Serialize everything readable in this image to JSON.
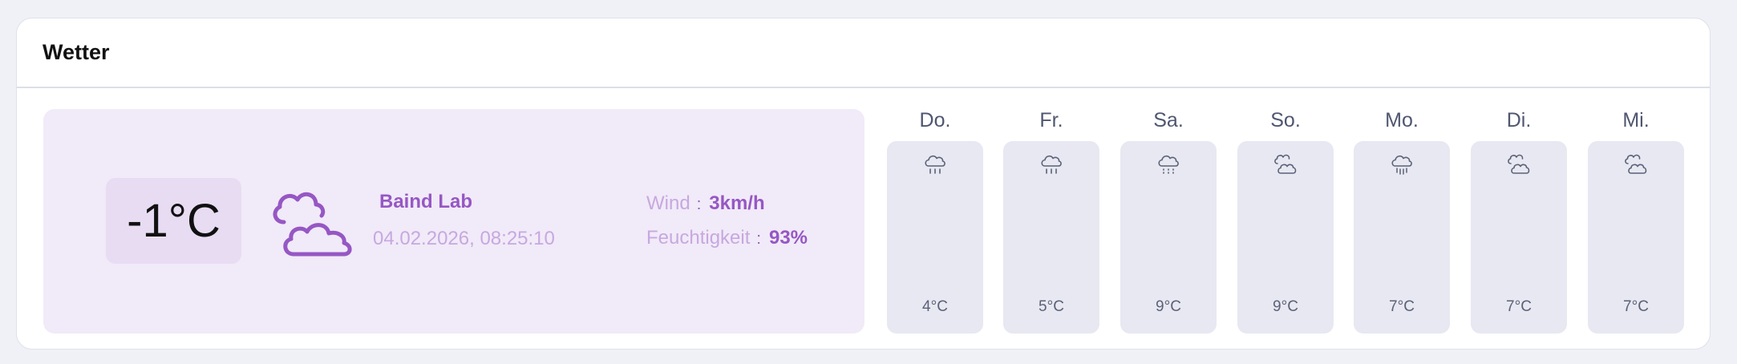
{
  "widget": {
    "title": "Wetter"
  },
  "current": {
    "temperature": "-1°C",
    "icon": "cloudy-icon",
    "location": "Baind Lab",
    "datetime": "04.02.2026, 08:25:10",
    "wind_label": "Wind",
    "wind_value": "3km/h",
    "humidity_label": "Feuchtigkeit",
    "humidity_value": "93%",
    "separator": ":"
  },
  "forecast": [
    {
      "day": "Do.",
      "icon": "rain-icon",
      "temp": "4°C"
    },
    {
      "day": "Fr.",
      "icon": "rain-icon",
      "temp": "5°C"
    },
    {
      "day": "Sa.",
      "icon": "drizzle-icon",
      "temp": "9°C"
    },
    {
      "day": "So.",
      "icon": "cloudy-icon",
      "temp": "9°C"
    },
    {
      "day": "Mo.",
      "icon": "showers-icon",
      "temp": "7°C"
    },
    {
      "day": "Di.",
      "icon": "cloudy-icon",
      "temp": "7°C"
    },
    {
      "day": "Mi.",
      "icon": "cloudy-icon",
      "temp": "7°C"
    }
  ],
  "colors": {
    "accent": "#9657c4",
    "accent_light": "#c7a8e0",
    "current_bg": "#f1eaf8",
    "forecast_bg": "#e7e8f1"
  }
}
